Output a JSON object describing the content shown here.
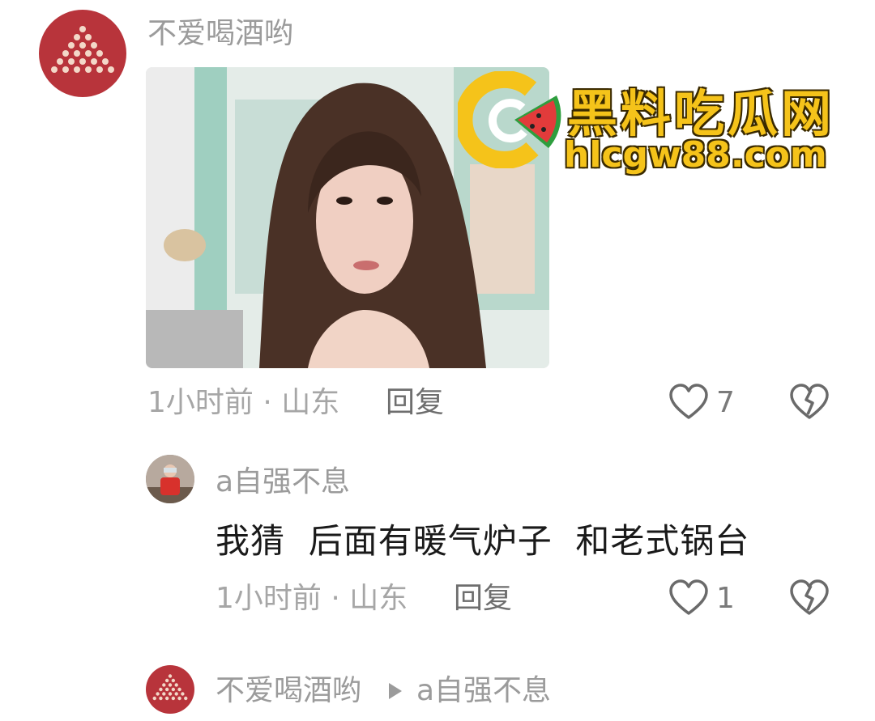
{
  "comment1": {
    "username": "不爱喝酒哟",
    "time_location": "1小时前 · 山东",
    "reply_label": "回复",
    "like_count": "7"
  },
  "comment2": {
    "username": "a自强不息",
    "text": "我猜  后面有暖气炉子  和老式锅台",
    "time_location": "1小时前 · 山东",
    "reply_label": "回复",
    "like_count": "1"
  },
  "comment3": {
    "username": "不爱喝酒哟",
    "reply_to": "a自强不息"
  },
  "watermark": {
    "title": "黑料吃瓜网",
    "url": "hlcgw88.com"
  },
  "colors": {
    "avatar_red": "#b8343b",
    "watermark_yellow": "#f5c31a",
    "muted_text": "#a6a6a6"
  },
  "icons": {
    "like": "heart-outline-icon",
    "dislike": "broken-heart-icon",
    "reply_arrow": "play-triangle-icon"
  }
}
